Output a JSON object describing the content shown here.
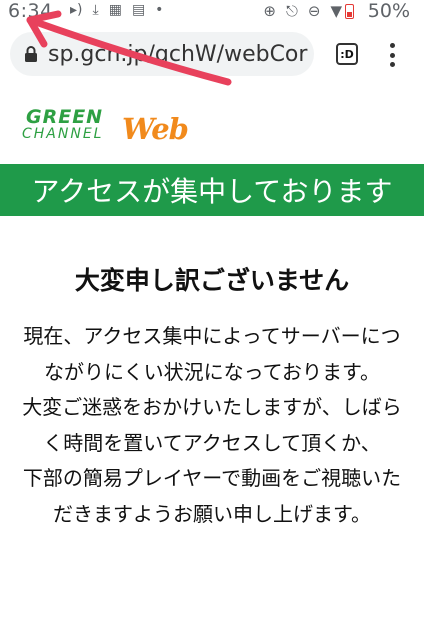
{
  "status_bar": {
    "time": "6:34",
    "battery": "50%",
    "left_icons": [
      "volume-icon",
      "download-icon",
      "translate-icon",
      "clipboard-icon",
      "dot-icon"
    ],
    "right_icons": [
      "data-saver-icon",
      "bell-off-icon",
      "do-not-disturb-icon",
      "wifi-icon",
      "battery-icon"
    ]
  },
  "browser": {
    "url": "sp.gch.jp/gchW/webCor",
    "tab_count": ":D"
  },
  "logo": {
    "green": "GREEN",
    "channel": "CHANNEL",
    "web": "Web"
  },
  "banner": {
    "text": "アクセスが集中しております"
  },
  "content": {
    "title": "大変申し訳ございません",
    "paragraphs": [
      "現在、アクセス集中によってサーバーにつながりにくい状況になっております。",
      "大変ご迷惑をおかけいたしますが、しばらく時間を置いてアクセスして頂くか、",
      "下部の簡易プレイヤーで動画をご視聴いただきますようお願い申し上げます。"
    ]
  },
  "colors": {
    "banner_bg": "#1f9a4a",
    "logo_green": "#2ea043",
    "logo_orange": "#f18a1c",
    "annotation_arrow": "#e8415c"
  }
}
